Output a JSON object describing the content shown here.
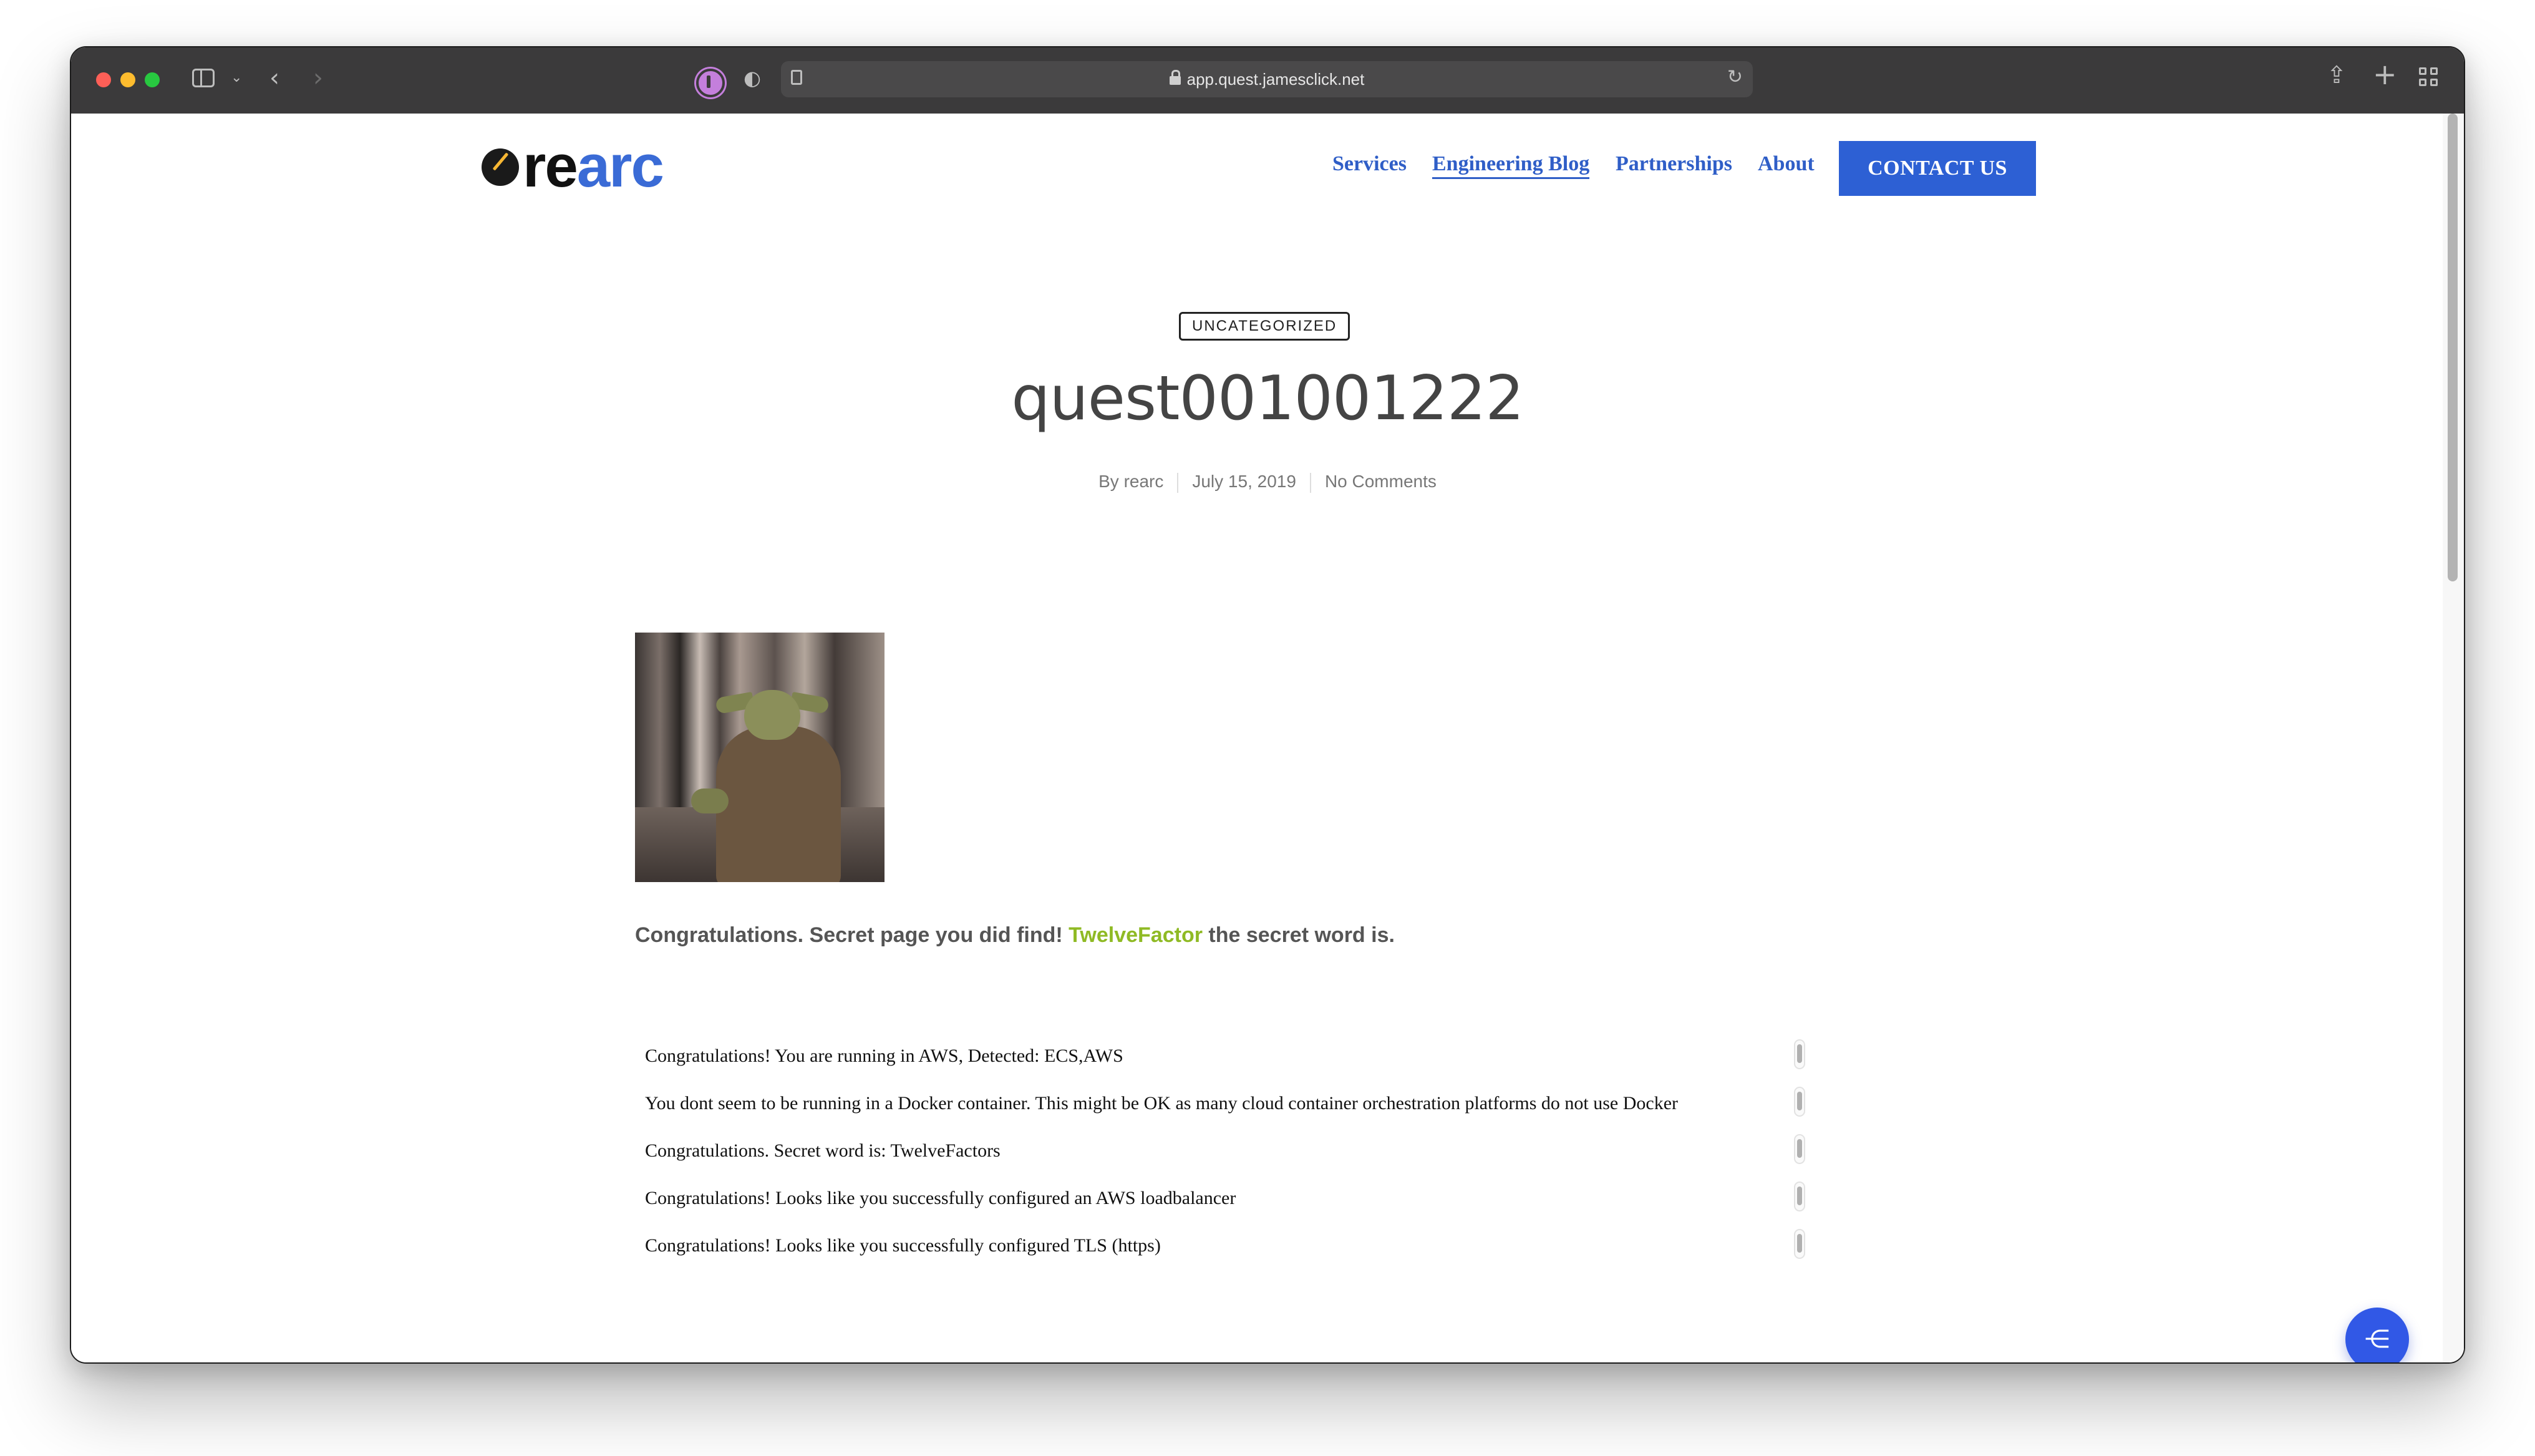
{
  "browser": {
    "url": "app.quest.jamesclick.net",
    "icons": [
      "sidebar-icon",
      "chevron-down-icon",
      "back-icon",
      "forward-icon",
      "password-manager-icon",
      "privacy-shield-icon",
      "reader-icon",
      "lock-icon",
      "reload-icon",
      "share-icon",
      "new-tab-icon",
      "tab-overview-icon"
    ]
  },
  "site": {
    "logo_prefix": "re",
    "logo_suffix": "arc",
    "brand_color": "#2d60d4",
    "nav": {
      "services": "Services",
      "blog": "Engineering Blog",
      "partnerships": "Partnerships",
      "about": "About",
      "contact": "CONTACT US"
    }
  },
  "post": {
    "category": "UNCATEGORIZED",
    "title": "quest001001222",
    "author": "By rearc",
    "date": "July 15, 2019",
    "comments": "No Comments",
    "secret_prefix": "Congratulations. Secret page you did find!",
    "secret_word": "TwelveFactor",
    "secret_suffix": "the secret word is.",
    "secret_word_color": "#8fba24",
    "results": [
      "Congratulations! You are running in AWS, Detected: ECS,AWS",
      "You dont seem to be running in a Docker container. This might be OK as many cloud container orchestration platforms do not use Docker",
      "Congratulations. Secret word is: TwelveFactors",
      "Congratulations! Looks like you successfully configured an AWS loadbalancer",
      "Congratulations! Looks like you successfully configured TLS (https)"
    ]
  }
}
